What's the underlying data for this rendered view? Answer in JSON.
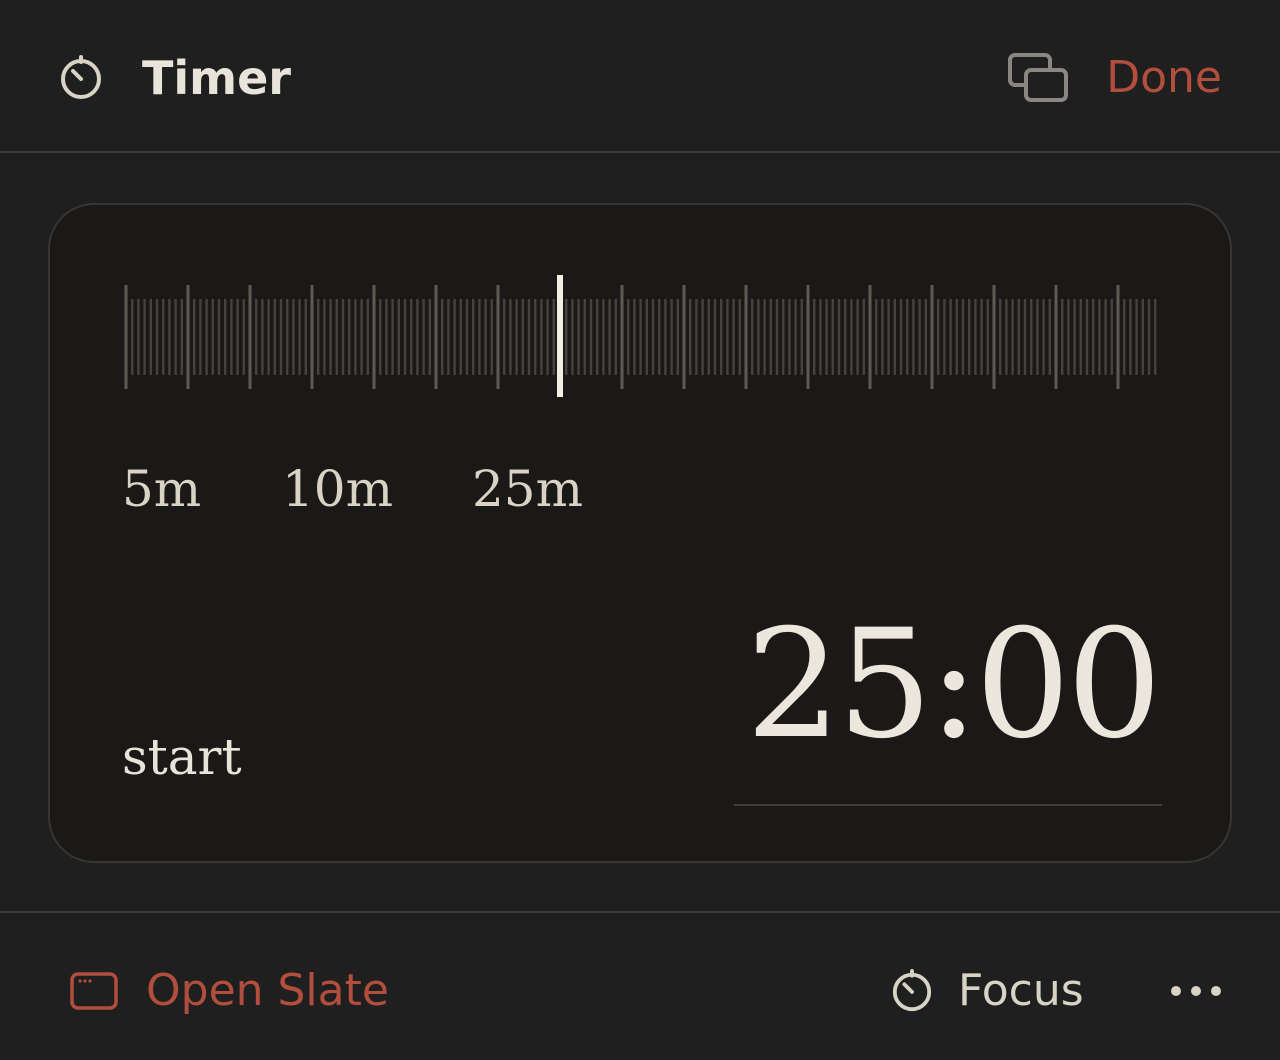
{
  "header": {
    "title": "Timer",
    "title_icon": "timer-icon",
    "popout_icon": "popout-windows-icon",
    "done_label": "Done"
  },
  "timer": {
    "presets": [
      "5m",
      "10m",
      "25m"
    ],
    "start_label": "start",
    "time": "25:00"
  },
  "footer": {
    "open_slate_label": "Open Slate",
    "open_slate_icon": "window-icon",
    "focus_label": "Focus",
    "focus_icon": "timer-icon",
    "more_icon": "more-horizontal-icon"
  },
  "colors": {
    "background": "#1f1f1f",
    "card": "#1a1918",
    "accent": "#b14e3d",
    "text": "#e8e4da"
  }
}
